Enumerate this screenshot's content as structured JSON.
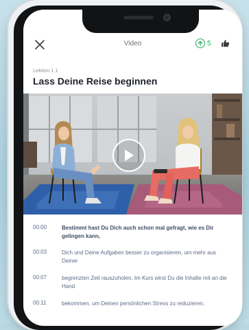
{
  "header": {
    "title": "Video",
    "points": "5"
  },
  "lesson": {
    "label": "Lektion 1.1",
    "title": "Lass Deine Reise beginnen"
  },
  "icons": {
    "close": "close-icon",
    "points": "arrow-up-circle-icon",
    "like": "thumbs-up-icon",
    "play": "play-icon"
  },
  "colors": {
    "accent_green": "#24b05a",
    "transcript_text": "#5e6a86"
  },
  "transcript": [
    {
      "time": "00:00",
      "text": "Bestimmt hast Du Dich auch schon mal gefragt, wie es Dir gelingen kann,"
    },
    {
      "time": "00:03",
      "text": "Dich und Deine Aufgaben besser zu organisieren, um mehr aus Deiner"
    },
    {
      "time": "00:07",
      "text": "begrenzten Zeit rauszuholen. Im Kurs wirst Du die Inhalte mit an die Hand"
    },
    {
      "time": "00:11",
      "text": "bekommen, um Deinen persönlichen Stress zu reduzieren,"
    }
  ]
}
